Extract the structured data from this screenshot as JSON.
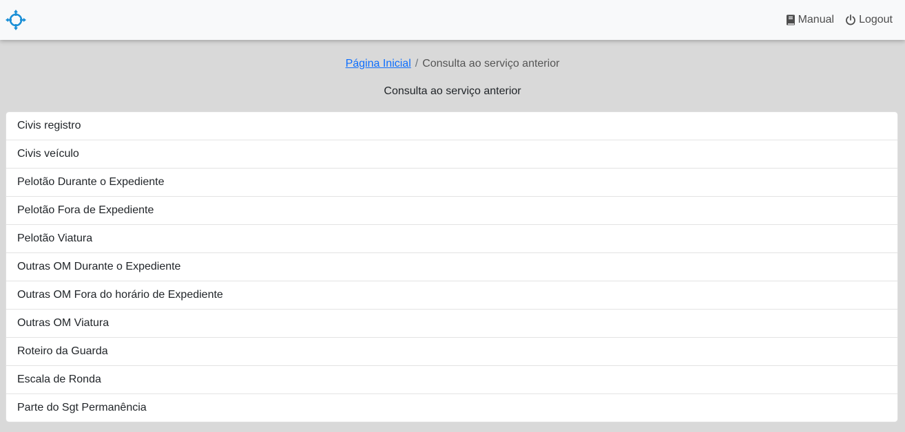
{
  "navbar": {
    "logo_icon": "crosshair-logo-icon",
    "accent_color": "#1a8fd6",
    "manual_icon": "book-icon",
    "manual_label": "Manual",
    "logout_icon": "power-icon",
    "logout_label": "Logout"
  },
  "breadcrumb": {
    "home_label": "Página Inicial",
    "separator": "/",
    "current_label": "Consulta ao serviço anterior"
  },
  "page_title": "Consulta ao serviço anterior",
  "list": {
    "items": [
      {
        "label": "Civis registro"
      },
      {
        "label": "Civis veículo"
      },
      {
        "label": "Pelotão Durante o Expediente"
      },
      {
        "label": "Pelotão Fora de Expediente"
      },
      {
        "label": "Pelotão Viatura"
      },
      {
        "label": "Outras OM Durante o Expediente"
      },
      {
        "label": "Outras OM Fora do horário de Expediente"
      },
      {
        "label": "Outras OM Viatura"
      },
      {
        "label": "Roteiro da Guarda"
      },
      {
        "label": "Escala de Ronda"
      },
      {
        "label": "Parte do Sgt Permanência"
      }
    ]
  }
}
